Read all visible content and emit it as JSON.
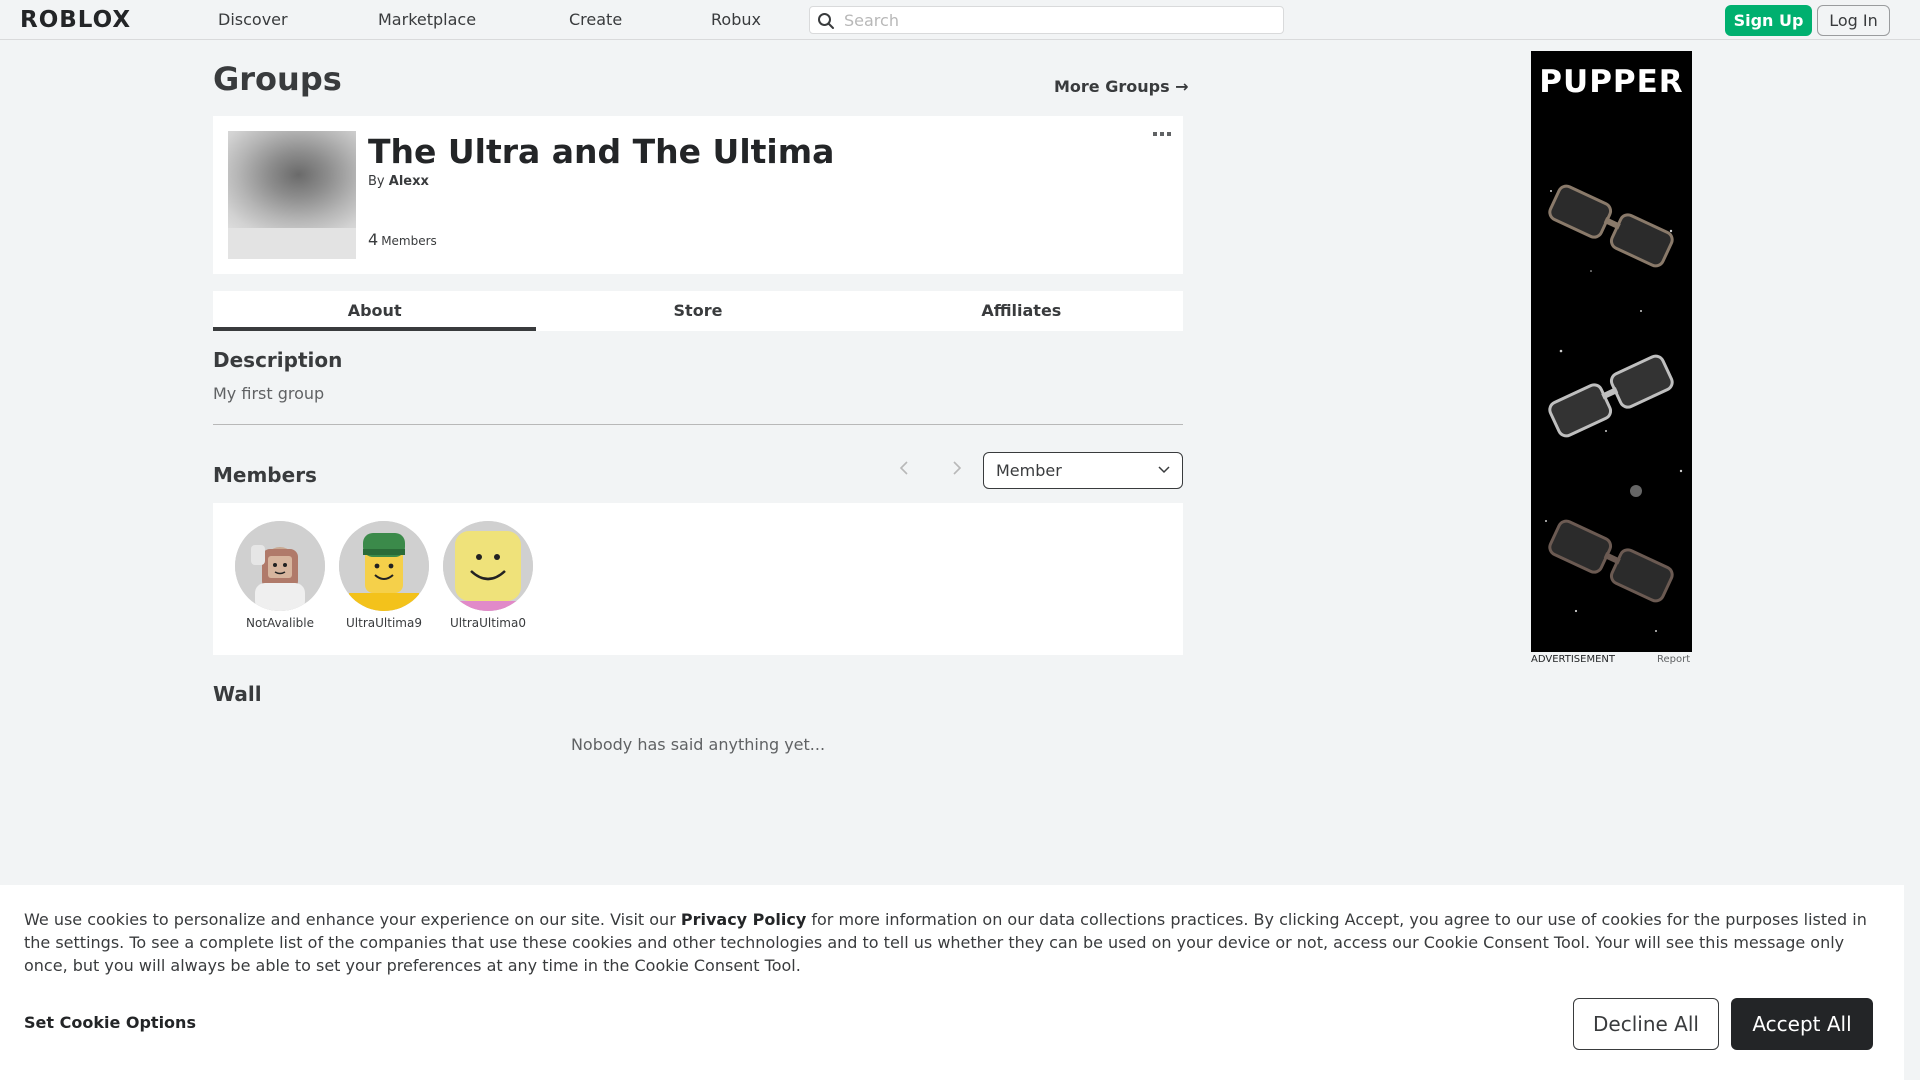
{
  "header": {
    "logo": "ROBLOX",
    "nav": [
      "Discover",
      "Marketplace",
      "Create",
      "Robux"
    ],
    "search_placeholder": "Search",
    "signup_label": "Sign Up",
    "login_label": "Log In"
  },
  "page": {
    "title": "Groups",
    "more_groups": "More Groups →"
  },
  "group": {
    "name": "The Ultra and The Ultima",
    "by_prefix": "By",
    "owner": "Alexx",
    "member_count": "4",
    "member_count_label": "Members"
  },
  "tabs": [
    {
      "label": "About",
      "active": true
    },
    {
      "label": "Store",
      "active": false
    },
    {
      "label": "Affiliates",
      "active": false
    }
  ],
  "description": {
    "heading": "Description",
    "text": "My first group"
  },
  "members": {
    "heading": "Members",
    "role_select": "Member",
    "list": [
      {
        "name": "NotAvalible",
        "avatar": "avatar-girl-icon"
      },
      {
        "name": "UltraUltima9",
        "avatar": "avatar-noob-cap-icon"
      },
      {
        "name": "UltraUltima0",
        "avatar": "avatar-noob-icon"
      }
    ]
  },
  "wall": {
    "heading": "Wall",
    "empty": "Nobody has said anything yet..."
  },
  "ad": {
    "brand": "PUPPER",
    "label": "ADVERTISEMENT",
    "report": "Report"
  },
  "cookie": {
    "text_before": "We use cookies to personalize and enhance your experience on our site. Visit our ",
    "policy_link": "Privacy Policy",
    "text_after": " for more information on our data collections practices. By clicking Accept, you agree to our use of cookies for the purposes listed in the settings. To see a complete list of the companies that use these cookies and other technologies and to tell us whether they can be used on your device or not, access our Cookie Consent Tool. Your will see this message only once, but you will always be able to set your preferences at any time in the Cookie Consent Tool.",
    "options_label": "Set Cookie Options",
    "decline_label": "Decline All",
    "accept_label": "Accept All"
  },
  "colors": {
    "accent_green": "#00b06f",
    "background": "#f2f4f5",
    "dark": "#232527"
  }
}
